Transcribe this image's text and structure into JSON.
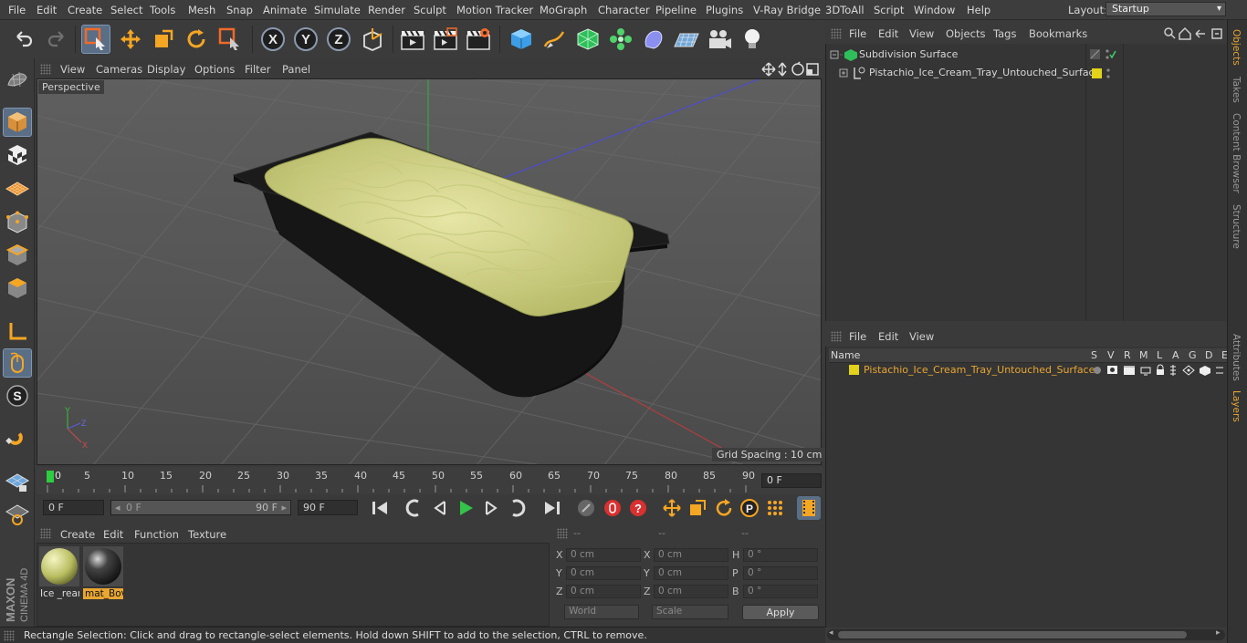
{
  "menu": [
    "File",
    "Edit",
    "Create",
    "Select",
    "Tools",
    "Mesh",
    "Snap",
    "Animate",
    "Simulate",
    "Render",
    "Sculpt",
    "Motion Tracker",
    "MoGraph",
    "Character",
    "Pipeline",
    "Plugins",
    "V-Ray Bridge",
    "3DToAll",
    "Script",
    "Window",
    "Help"
  ],
  "layout": {
    "label": "Layout:",
    "value": "Startup"
  },
  "viewport": {
    "menu": [
      "View",
      "Cameras",
      "Display",
      "Options",
      "Filter",
      "Panel"
    ],
    "label": "Perspective",
    "grid_spacing": "Grid Spacing : 10 cm"
  },
  "timeline": {
    "ticks": [
      "0",
      "5",
      "10",
      "15",
      "20",
      "25",
      "30",
      "35",
      "40",
      "45",
      "50",
      "55",
      "60",
      "65",
      "70",
      "75",
      "80",
      "85",
      "90"
    ],
    "current_frame": "0 F",
    "start_field": "0 F",
    "range_start": "0 F",
    "range_end": "90 F",
    "end_field": "90 F"
  },
  "materials": {
    "menu": [
      "Create",
      "Edit",
      "Function",
      "Texture"
    ],
    "items": [
      {
        "label": "Ice _rear"
      },
      {
        "label": "mat_Bov"
      }
    ]
  },
  "coords": {
    "headers": [
      "--",
      "--",
      "--"
    ],
    "rows": [
      {
        "a": "X",
        "av": "0 cm",
        "b": "X",
        "bv": "0 cm",
        "c": "H",
        "cv": "0 °"
      },
      {
        "a": "Y",
        "av": "0 cm",
        "b": "Y",
        "bv": "0 cm",
        "c": "P",
        "cv": "0 °"
      },
      {
        "a": "Z",
        "av": "0 cm",
        "b": "Z",
        "bv": "0 cm",
        "c": "B",
        "cv": "0 °"
      }
    ],
    "world": "World",
    "scale": "Scale",
    "apply": "Apply"
  },
  "status": "Rectangle Selection: Click and drag to rectangle-select elements. Hold down SHIFT to add to the selection, CTRL to remove.",
  "objects": {
    "menu": [
      "File",
      "Edit",
      "View",
      "Objects",
      "Tags",
      "Bookmarks"
    ],
    "items": [
      {
        "name": "Subdivision Surface"
      },
      {
        "name": "Pistachio_Ice_Cream_Tray_Untouched_Surface"
      }
    ]
  },
  "layers": {
    "menu": [
      "File",
      "Edit",
      "View"
    ],
    "header": {
      "name": "Name",
      "cols": [
        "S",
        "V",
        "R",
        "M",
        "L",
        "A",
        "G",
        "D",
        "E"
      ]
    },
    "items": [
      {
        "name": "Pistachio_Ice_Cream_Tray_Untouched_Surface",
        "color": "#e3d21a"
      }
    ]
  },
  "right_tabs": [
    "Objects",
    "Takes",
    "Content Browser",
    "Structure",
    "Attributes",
    "Layers"
  ],
  "brand": {
    "line1": "MAXON",
    "line2": "CINEMA 4D"
  },
  "colors": {
    "accent": "#e8a632",
    "selected_tool": "#5a6e86",
    "layer_yellow": "#e3d21a",
    "pistachio": "#d8dc8a"
  }
}
